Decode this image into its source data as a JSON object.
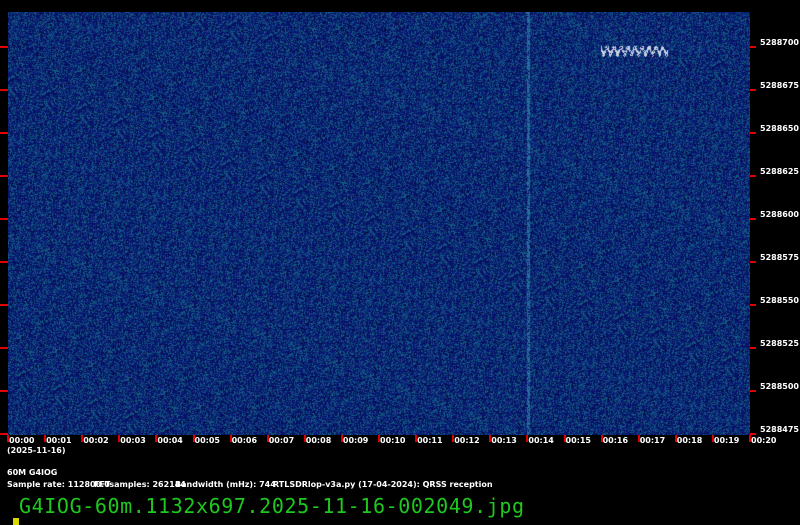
{
  "waterfall": {
    "background_color": "#0a1a6e",
    "noise_color": "#1e6e8c",
    "signal_color": "#c8d2e6",
    "freq_labels": [
      "5288700",
      "5288675",
      "5288650",
      "5288625",
      "5288600",
      "5288575",
      "5288550",
      "5288525",
      "5288500",
      "5288475"
    ],
    "time_labels": [
      "00:00",
      "00:01",
      "00:02",
      "00:03",
      "00:04",
      "00:05",
      "00:06",
      "00:07",
      "00:08",
      "00:09",
      "00:10",
      "00:11",
      "00:12",
      "00:13",
      "00:14",
      "00:15",
      "00:16",
      "00:17",
      "00:18",
      "00:19",
      "00:20"
    ],
    "date_label": "(2025-11-16)"
  },
  "info": {
    "station": "60M G4IOG",
    "sample_rate": "Sample rate: 112800.0",
    "fft_samples": "FFTsamples: 262144",
    "bandwidth": "Bandwidth (mHz): 744",
    "software": "RTLSDRlop-v3a.py (17-04-2024): QRSS reception"
  },
  "filename": "G4IOG-60m.1132x697.2025-11-16-002049.jpg"
}
